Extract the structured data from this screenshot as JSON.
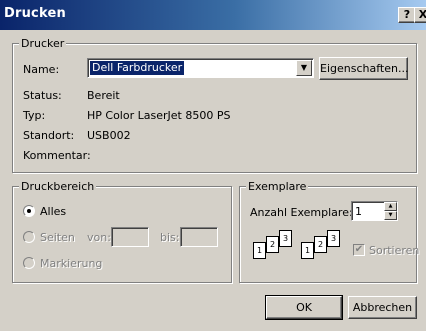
{
  "window": {
    "title": "Drucken",
    "help_glyph": "?",
    "close_glyph": "X"
  },
  "printer": {
    "group_label": "Drucker",
    "name_label": "Name:",
    "selected_printer": "Dell Farbdrucker",
    "properties_button": "Eigenschaften...",
    "status_label": "Status:",
    "status_value": "Bereit",
    "type_label": "Typ:",
    "type_value": "HP Color LaserJet 8500 PS",
    "location_label": "Standort:",
    "location_value": "USB002",
    "comment_label": "Kommentar:",
    "comment_value": ""
  },
  "print_range": {
    "group_label": "Druckbereich",
    "all_label": "Alles",
    "all_selected": true,
    "pages_label": "Seiten",
    "from_label": "von:",
    "from_value": "",
    "to_label": "bis:",
    "to_value": "",
    "selection_label": "Markierung"
  },
  "copies": {
    "group_label": "Exemplare",
    "count_label": "Anzahl Exemplare:",
    "count_value": "1",
    "collate_label": "Sortieren",
    "collate_checked": true,
    "collate_enabled": false,
    "page_numbers": [
      "1",
      "2",
      "3"
    ]
  },
  "footer": {
    "ok_label": "OK",
    "cancel_label": "Abbrechen"
  },
  "colors": {
    "face": "#d4d0c8",
    "title_active": "#0a246a",
    "title_gradient_end": "#a6caf0",
    "selection": "#0a246a",
    "disabled_text": "#808080"
  }
}
